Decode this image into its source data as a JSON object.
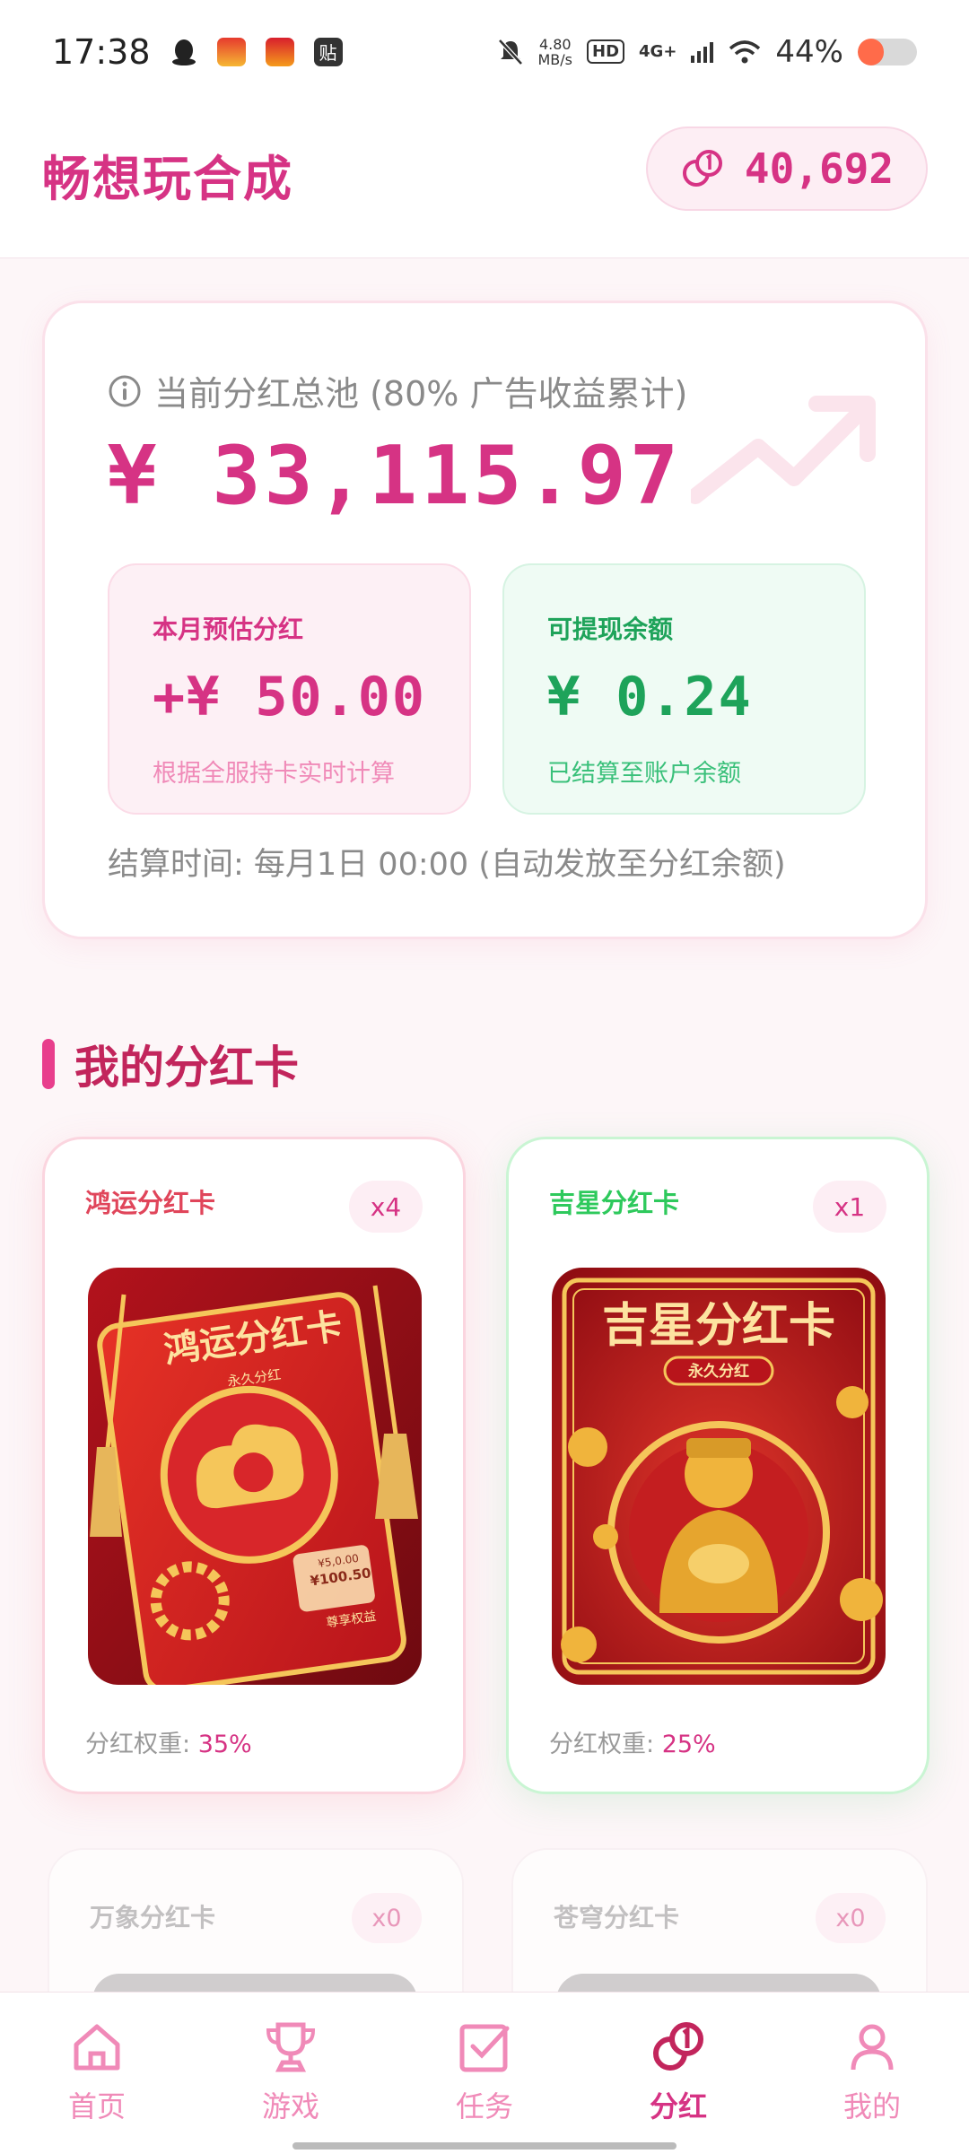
{
  "status_bar": {
    "time": "17:38",
    "net_speed_value": "4.80",
    "net_speed_unit": "MB/s",
    "hd_badge": "HD",
    "network": "4G+",
    "battery_text": "44%",
    "battery_level": 0.44,
    "app_badge_label": "贴"
  },
  "header": {
    "title": "畅想玩合成",
    "coin_balance": "40,692"
  },
  "pool": {
    "label": "当前分红总池 (80% 广告收益累计)",
    "amount": "¥ 33,115.97",
    "monthly_title": "本月预估分红",
    "monthly_value": "+¥ 50.00",
    "monthly_note": "根据全服持卡实时计算",
    "withdraw_title": "可提现余额",
    "withdraw_value": "¥ 0.24",
    "withdraw_note": "已结算至账户余额",
    "settle_note": "结算时间: 每月1日 00:00 (自动发放至分红余额)"
  },
  "section": {
    "title": "我的分红卡"
  },
  "cards": [
    {
      "name": "鸿运分红卡",
      "count": "x4",
      "weight_label": "分红权重:",
      "weight_value": "35%",
      "image_title": "鸿运分红卡",
      "image_subtitle": "永久分红",
      "image_price_old": "¥5,0.00",
      "image_price": "¥100.50",
      "image_footer": "尊享权益",
      "accent": "#e0455a"
    },
    {
      "name": "吉星分红卡",
      "count": "x1",
      "weight_label": "分红权重:",
      "weight_value": "25%",
      "image_title": "吉星分红卡",
      "image_subtitle": "永久分红",
      "accent": "#2ec95c"
    }
  ],
  "cards_faded": [
    {
      "name": "万象分红卡",
      "count": "x0"
    },
    {
      "name": "苍穹分红卡",
      "count": "x0"
    }
  ],
  "nav": [
    {
      "label": "首页",
      "icon": "home-icon"
    },
    {
      "label": "游戏",
      "icon": "trophy-icon"
    },
    {
      "label": "任务",
      "icon": "task-check-icon"
    },
    {
      "label": "分红",
      "icon": "dividend-coins-icon"
    },
    {
      "label": "我的",
      "icon": "user-icon"
    }
  ],
  "colors": {
    "brand_pink": "#d63384",
    "green": "#1ea35a"
  }
}
